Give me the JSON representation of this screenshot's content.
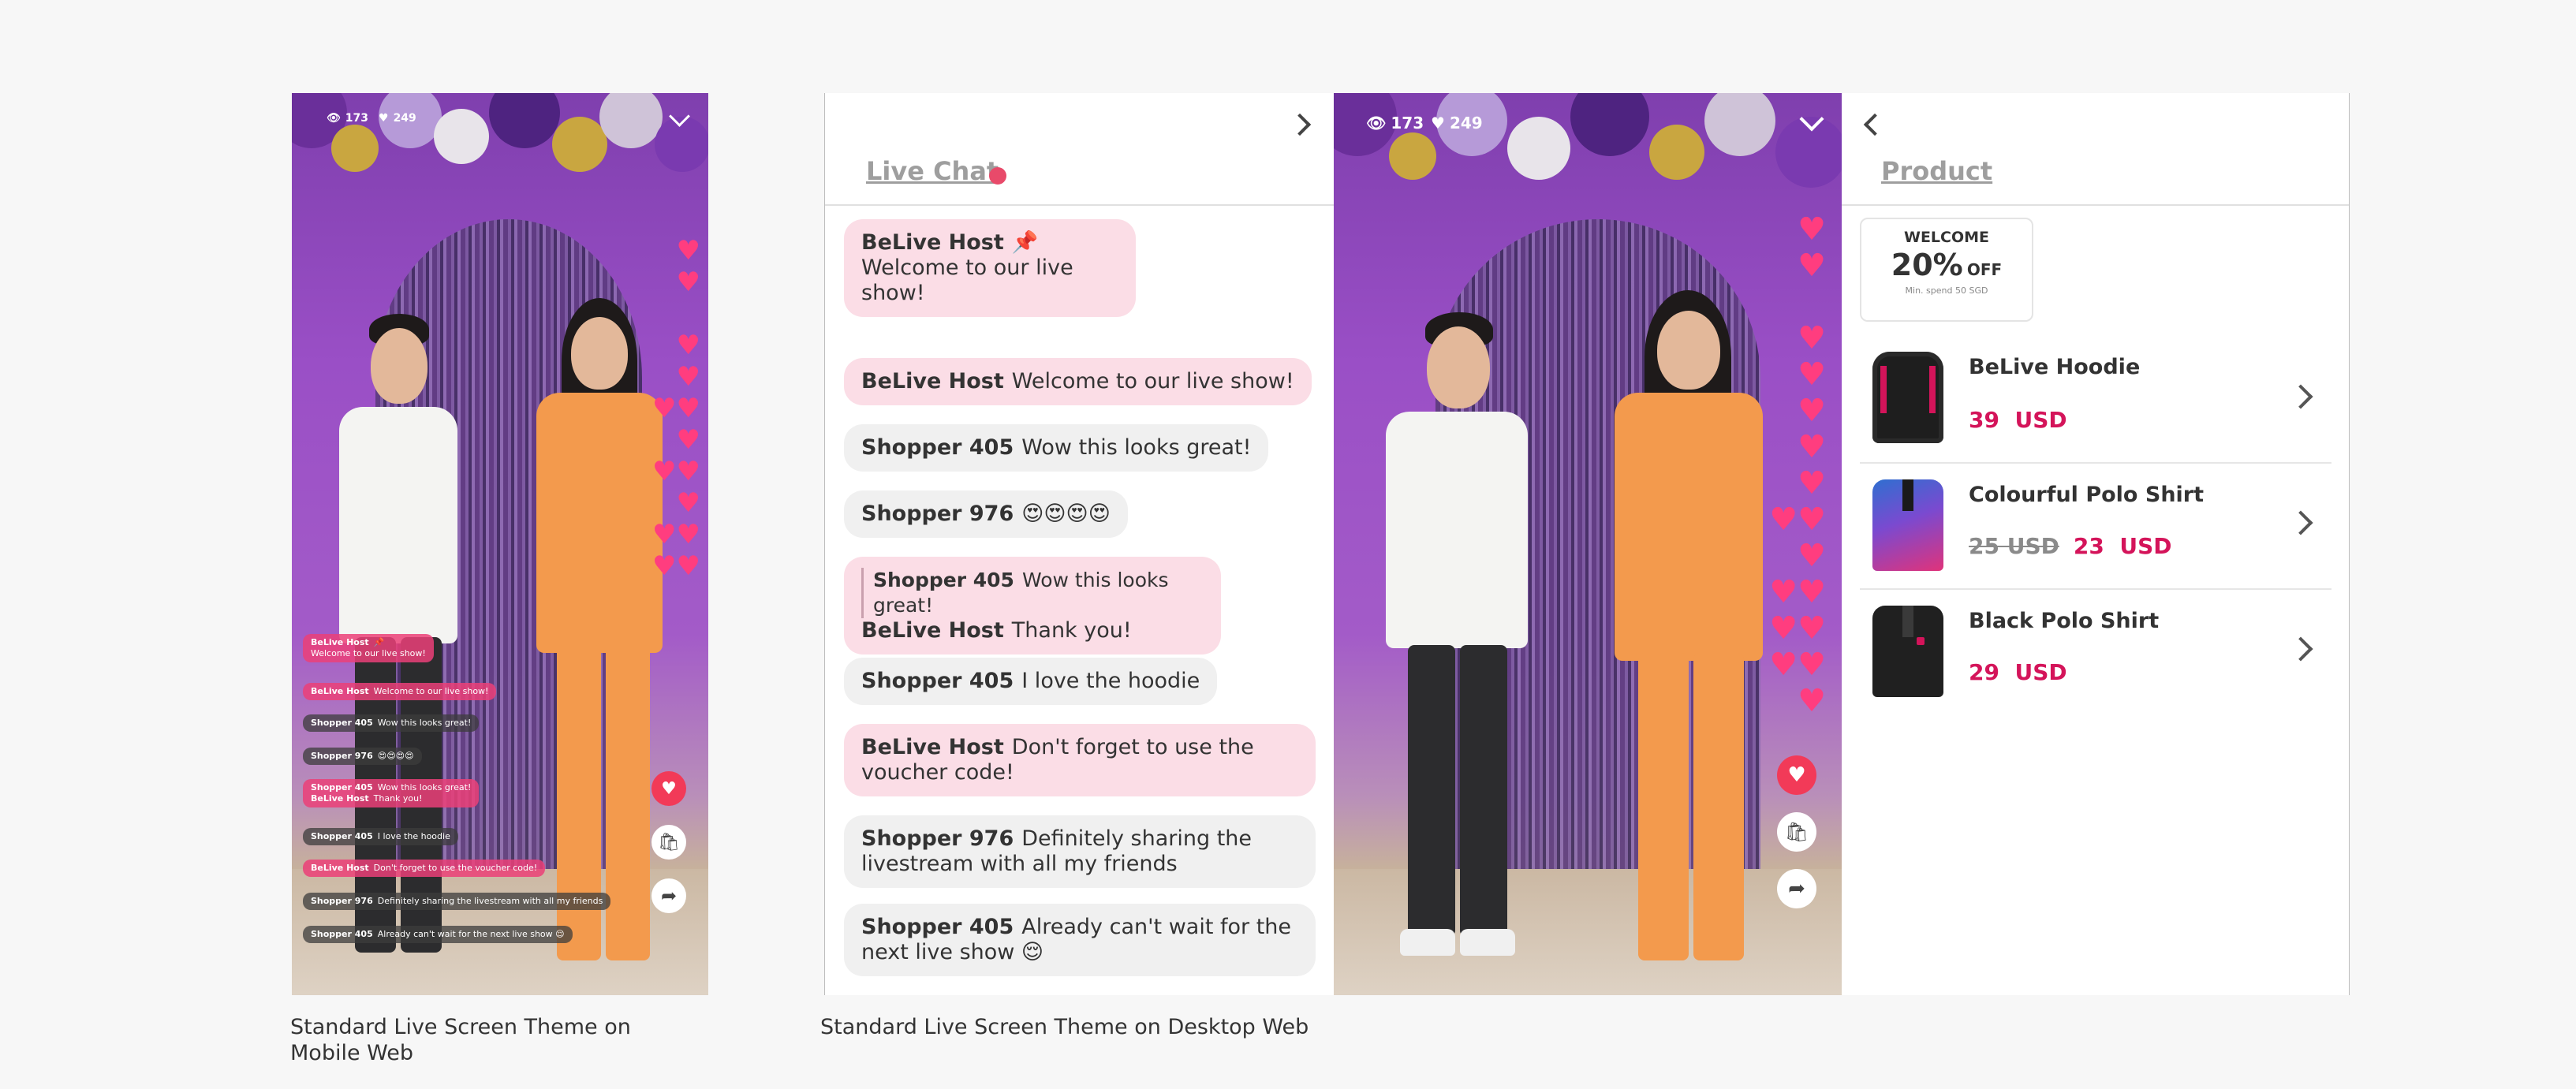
{
  "mobile": {
    "viewers": "173",
    "likes": "249",
    "messages": [
      {
        "author": "BeLive Host",
        "pin": "📌",
        "text": "Welcome to our live show!",
        "host": true
      },
      {
        "author": "BeLive Host",
        "text": "Welcome to our live show!",
        "host": true
      },
      {
        "author": "Shopper 405",
        "text": "Wow this looks great!",
        "host": false
      },
      {
        "author": "Shopper 976",
        "text": "😍😍😍😍",
        "host": false
      },
      {
        "reply_author": "Shopper 405",
        "reply_text": "Wow this looks great!",
        "author": "BeLive Host",
        "text": "Thank you!",
        "host": true
      },
      {
        "author": "Shopper 405",
        "text": "I love the hoodie",
        "host": false
      },
      {
        "author": "BeLive Host",
        "text": "Don't forget to use the voucher code!",
        "host": true
      },
      {
        "author": "Shopper 976",
        "text": "Definitely sharing the livestream with all my friends",
        "host": false
      },
      {
        "author": "Shopper 405",
        "text": "Already can't wait for the next live show 😌",
        "host": false
      }
    ]
  },
  "desktop": {
    "chat_title": "Live Chat",
    "viewers": "173",
    "likes": "249",
    "pinned": {
      "author": "BeLive Host",
      "pin": "📌",
      "text": "Welcome to our live show!"
    },
    "messages": [
      {
        "author": "BeLive Host",
        "text": "Welcome to our live show!",
        "host": true
      },
      {
        "author": "Shopper 405",
        "text": "Wow this looks great!",
        "host": false
      },
      {
        "author": "Shopper 976",
        "text": "😍😍😍😍",
        "host": false
      },
      {
        "reply_author": "Shopper 405",
        "reply_text": "Wow this looks great!",
        "author": "BeLive Host",
        "text": "Thank you!",
        "host": true
      },
      {
        "author": "Shopper 405",
        "text": "I love the hoodie",
        "host": false
      },
      {
        "author": "BeLive Host",
        "text": "Don't forget to use the voucher code!",
        "host": true
      },
      {
        "author": "Shopper 976",
        "text": "Definitely sharing the livestream with all my friends",
        "host": false
      },
      {
        "author": "Shopper 405",
        "text": "Already can't wait for the next live show 😌",
        "host": false
      }
    ],
    "product_title": "Product",
    "voucher": {
      "label": "WELCOME",
      "amount": "20%",
      "off": "OFF",
      "min": "Min. spend 50 SGD"
    },
    "products": [
      {
        "name": "BeLive Hoodie",
        "old_price": "",
        "price": "39",
        "currency": "USD",
        "color": "#1e1e1e",
        "accent": "#d4145a"
      },
      {
        "name": "Colourful Polo Shirt",
        "old_price": "25 USD",
        "price": "23",
        "currency": "USD",
        "color": "#2f6fd0",
        "accent": "#e0337a"
      },
      {
        "name": "Black Polo Shirt",
        "old_price": "",
        "price": "29",
        "currency": "USD",
        "color": "#202020",
        "accent": "#d4145a"
      }
    ]
  },
  "captions": {
    "mobile_line1": "Standard Live Screen Theme on",
    "mobile_line2": "Mobile Web",
    "desktop": "Standard Live Screen Theme on Desktop Web"
  },
  "colors": {
    "accent": "#d4145a",
    "host_bubble": "#fbdde6",
    "bubble": "#f0f0f0",
    "heart": "#ff3d7f"
  }
}
